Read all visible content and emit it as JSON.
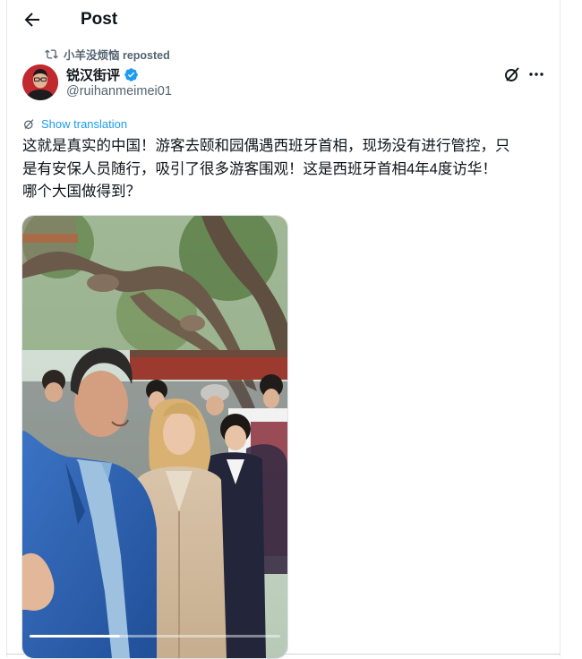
{
  "header": {
    "title": "Post"
  },
  "repost": {
    "text": "小羊没烦恼 reposted"
  },
  "author": {
    "name": "锐汉街评",
    "handle": "@ruihanmeimei01"
  },
  "translation": {
    "label": "Show translation"
  },
  "post": {
    "lines": [
      "这就是真实的中国！游客去颐和园偶遇西班牙首相，现场没有进行管控，只",
      "是有安保人员随行，吸引了很多游客围观！这是西班牙首相4年4度访华！",
      "哪个大国做得到？"
    ]
  },
  "colors": {
    "accent": "#1d9bf0",
    "text": "#0f1419",
    "muted": "#536471"
  },
  "icons": [
    "back-arrow-icon",
    "repost-icon",
    "verified-icon",
    "grok-icon",
    "more-icon",
    "translate-icon"
  ],
  "media": {
    "progress": 0.36
  }
}
